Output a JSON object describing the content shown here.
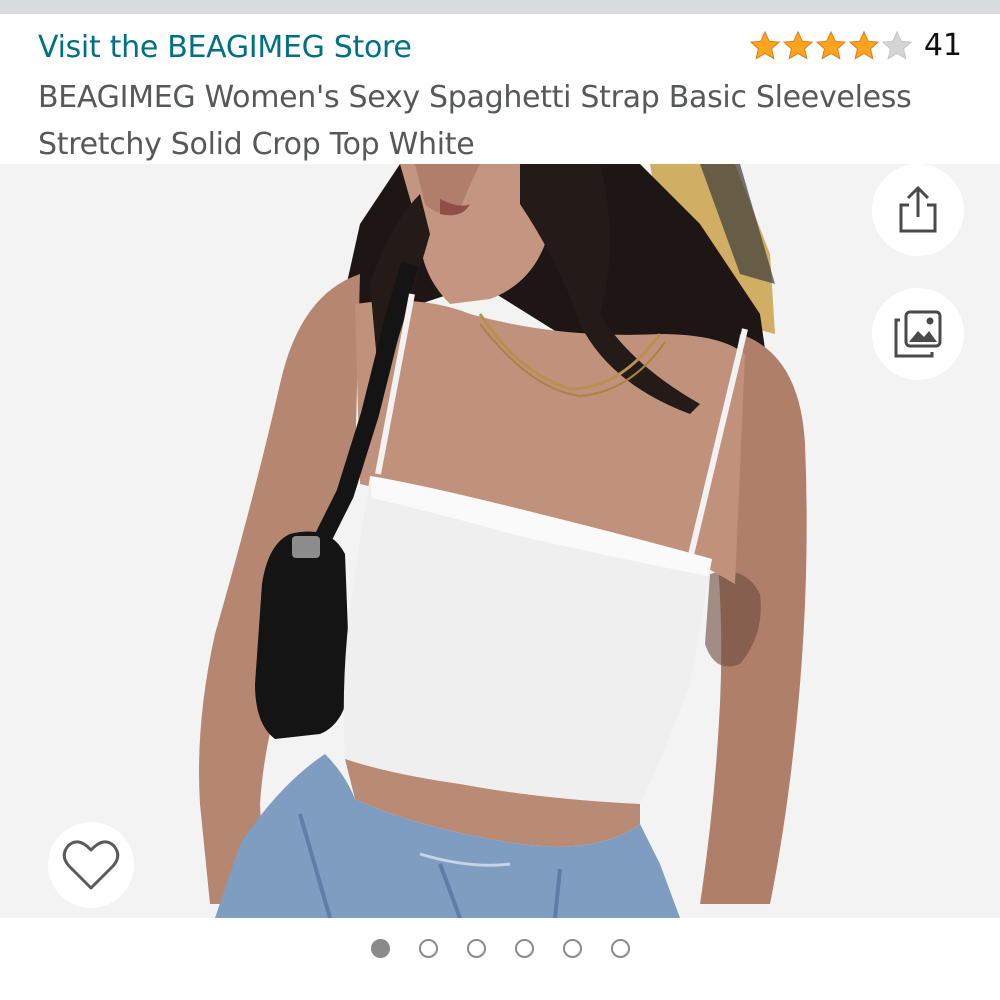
{
  "store": {
    "link_label": "Visit the BEAGIMEG Store"
  },
  "rating": {
    "stars": 4,
    "max_stars": 5,
    "count": "41",
    "star_color": "#ffa41c",
    "empty_star_color": "#d5d5d5"
  },
  "product": {
    "title": "BEAGIMEG Women's Sexy Spaghetti Strap Basic Sleeveless Stretchy Solid Crop Top White"
  },
  "image_actions": {
    "share_icon": "share-icon",
    "gallery_icon": "image-gallery-icon",
    "wishlist_icon": "heart-outline-icon"
  },
  "carousel": {
    "total": 6,
    "active_index": 0
  },
  "colors": {
    "link": "#007185",
    "title": "#565959",
    "image_bg": "#f3f3f3"
  }
}
